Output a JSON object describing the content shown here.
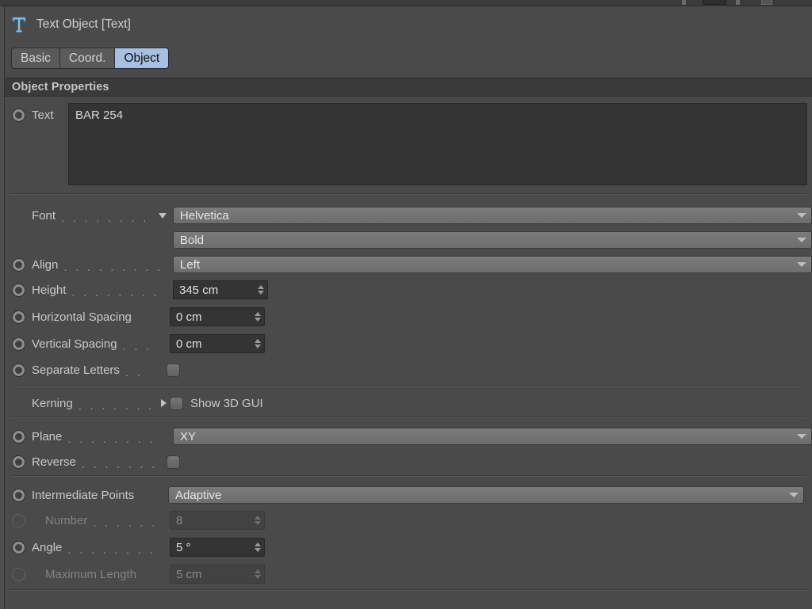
{
  "window": {
    "title": "Text Object [Text]",
    "icon": "text-object-icon"
  },
  "tabs": [
    {
      "label": "Basic",
      "active": false
    },
    {
      "label": "Coord.",
      "active": false
    },
    {
      "label": "Object",
      "active": true
    }
  ],
  "section": {
    "title": "Object Properties"
  },
  "properties": {
    "text": {
      "label": "Text",
      "value": "BAR 254"
    },
    "font": {
      "label": "Font",
      "family": "Helvetica",
      "style": "Bold"
    },
    "align": {
      "label": "Align",
      "value": "Left"
    },
    "height": {
      "label": "Height",
      "value": "345 cm"
    },
    "horizontal_spacing": {
      "label": "Horizontal Spacing",
      "value": "0 cm"
    },
    "vertical_spacing": {
      "label": "Vertical Spacing",
      "value": "0 cm"
    },
    "separate_letters": {
      "label": "Separate Letters",
      "checked": false
    },
    "kerning": {
      "label": "Kerning",
      "expanded": false,
      "show_3d_gui": {
        "label": "Show 3D GUI",
        "checked": false
      }
    },
    "plane": {
      "label": "Plane",
      "value": "XY"
    },
    "reverse": {
      "label": "Reverse",
      "checked": false
    },
    "intermediate_points": {
      "label": "Intermediate Points",
      "value": "Adaptive"
    },
    "number": {
      "label": "Number",
      "value": "8",
      "enabled": false
    },
    "angle": {
      "label": "Angle",
      "value": "5 °",
      "enabled": true
    },
    "maximum_length": {
      "label": "Maximum Length",
      "value": "5 cm",
      "enabled": false
    }
  },
  "dot_leaders": {
    "font": ". . . . . . . .",
    "align": ". . . . . . . . . . .",
    "height": ". . . . . . . . . .",
    "horizontal_spacing": "",
    "vertical_spacing": ". . .",
    "separate_letters": ". .",
    "kerning": ". . . . . . .",
    "plane": ". . . . . . . . . .",
    "reverse": ". . . . . . . . .",
    "intermediate_points": "",
    "number": ". . . . . . . . .",
    "angle": ". . . . . . . . . .",
    "maximum_length": ""
  },
  "colors": {
    "panel_bg": "#4a4a4a",
    "section_header_bg": "#3a3a3a",
    "active_tab_bg": "#a6c0e4",
    "field_bg": "#343434",
    "dropdown_bg": "#737373",
    "text": "#c9c9c9",
    "icon_accent": "#7fb4e0"
  }
}
